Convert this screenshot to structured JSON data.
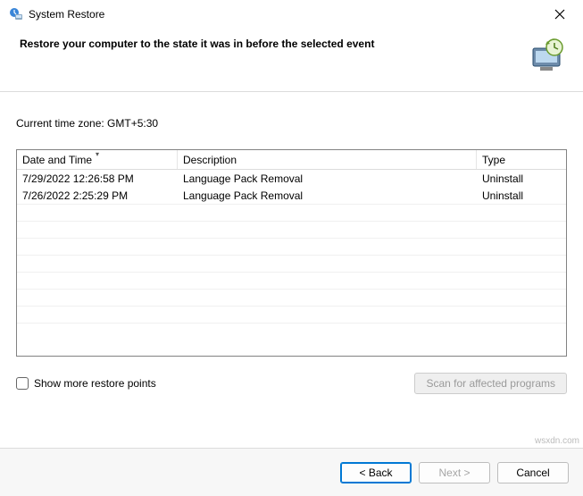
{
  "window": {
    "title": "System Restore",
    "heading": "Restore your computer to the state it was in before the selected event"
  },
  "timezone_line": "Current time zone: GMT+5:30",
  "table": {
    "headers": {
      "datetime": "Date and Time",
      "description": "Description",
      "type": "Type"
    },
    "rows": [
      {
        "datetime": "7/29/2022 12:26:58 PM",
        "description": "Language Pack Removal",
        "type": "Uninstall"
      },
      {
        "datetime": "7/26/2022 2:25:29 PM",
        "description": "Language Pack Removal",
        "type": "Uninstall"
      }
    ]
  },
  "checkbox_label": "Show more restore points",
  "scan_button": "Scan for affected programs",
  "buttons": {
    "back": "< Back",
    "next": "Next >",
    "cancel": "Cancel"
  },
  "watermark": "wsxdn.com"
}
